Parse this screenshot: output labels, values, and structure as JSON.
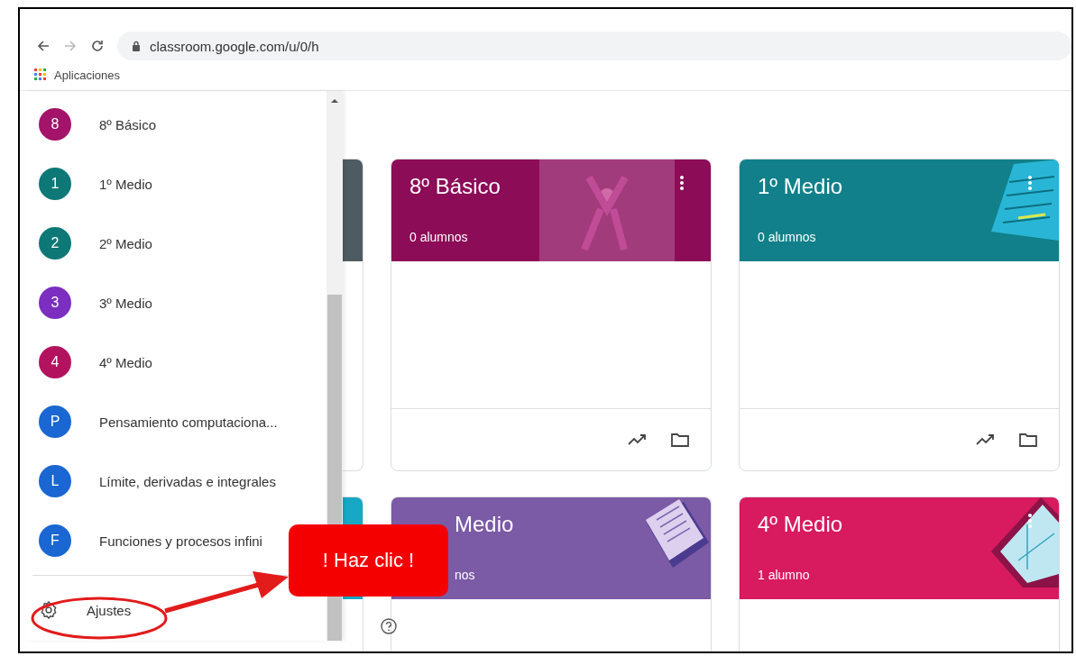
{
  "browser": {
    "url": "classroom.google.com/u/0/h",
    "bookmarks": [
      {
        "label": "Aplicaciones"
      }
    ]
  },
  "drawer": {
    "classes": [
      {
        "initial": "8",
        "name": "8º Básico",
        "color": "#a3136a"
      },
      {
        "initial": "1",
        "name": "1º Medio",
        "color": "#0d7876"
      },
      {
        "initial": "2",
        "name": "2º Medio",
        "color": "#0d7876"
      },
      {
        "initial": "3",
        "name": "3º Medio",
        "color": "#7b2ec0"
      },
      {
        "initial": "4",
        "name": "4º Medio",
        "color": "#b3125f"
      },
      {
        "initial": "P",
        "name": "Pensamiento computaciona...",
        "color": "#1a66d2"
      },
      {
        "initial": "L",
        "name": "Límite, derivadas e integrales",
        "color": "#1a66d2"
      },
      {
        "initial": "F",
        "name": "Funciones y procesos infini",
        "color": "#1a66d2"
      }
    ],
    "settings": {
      "label": "Ajustes"
    }
  },
  "cards": [
    {
      "title": "8º Básico",
      "students": "0 alumnos",
      "color": "#8c0c57",
      "kind": "photo",
      "covered": false,
      "footer": true
    },
    {
      "title": "1º Medio",
      "students": "0 alumnos",
      "color": "#11808a",
      "kind": "paper",
      "covered": false,
      "footer": true
    },
    {
      "title": "Medio",
      "students": "nos",
      "color": "#7b5aa6",
      "kind": "notebook",
      "covered": true,
      "footer": false
    },
    {
      "title": "4º Medio",
      "students": "1 alumno",
      "color": "#d81a5e",
      "kind": "tablet",
      "covered": false,
      "footer": false
    }
  ],
  "callout": {
    "text": "! Haz clic !"
  }
}
